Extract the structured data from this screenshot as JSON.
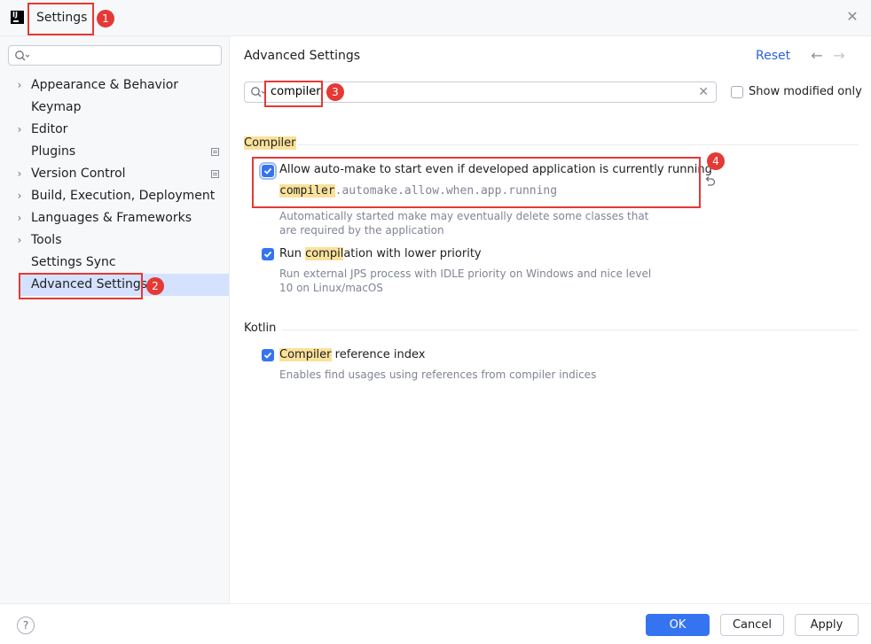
{
  "window": {
    "title": "Settings",
    "app_icon_text": "IJ"
  },
  "sidebar": {
    "search_placeholder": "",
    "items": [
      {
        "label": "Appearance & Behavior",
        "expandable": true
      },
      {
        "label": "Keymap",
        "expandable": false
      },
      {
        "label": "Editor",
        "expandable": true
      },
      {
        "label": "Plugins",
        "expandable": false
      },
      {
        "label": "Version Control",
        "expandable": true
      },
      {
        "label": "Build, Execution, Deployment",
        "expandable": true
      },
      {
        "label": "Languages & Frameworks",
        "expandable": true
      },
      {
        "label": "Tools",
        "expandable": true
      },
      {
        "label": "Settings Sync",
        "expandable": false
      },
      {
        "label": "Advanced Settings",
        "expandable": false,
        "selected": true
      }
    ]
  },
  "main": {
    "title": "Advanced Settings",
    "reset_label": "Reset",
    "search_value": "compiler",
    "show_modified_label": "Show modified only",
    "groups": [
      {
        "title": "Compiler",
        "options": [
          {
            "label": "Allow auto-make to start even if developed application is currently running",
            "key_highlight": "compiler",
            "key_rest": ".automake.allow.when.app.running",
            "desc_line1": "Automatically started make may eventually delete some classes that",
            "desc_line2": "are required by the application",
            "checked": true
          },
          {
            "label_pre": "Run ",
            "label_hl": "compil",
            "label_post": "ation with lower priority",
            "desc_line1": "Run external JPS process with IDLE priority on Windows and nice level",
            "desc_line2": "10 on Linux/macOS",
            "checked": true
          }
        ]
      },
      {
        "title": "Kotlin",
        "options": [
          {
            "label_hl": "Compiler",
            "label_post": " reference index",
            "desc_line1": "Enables find usages using references from compiler indices",
            "checked": true
          }
        ]
      }
    ]
  },
  "footer": {
    "help_label": "?",
    "ok_label": "OK",
    "cancel_label": "Cancel",
    "apply_label": "Apply"
  },
  "annotations": [
    "1",
    "2",
    "3",
    "4"
  ],
  "colors": {
    "accent": "#3574f0",
    "annotation": "#e53935",
    "highlight": "#fae29b",
    "selection": "#d4e2ff"
  }
}
